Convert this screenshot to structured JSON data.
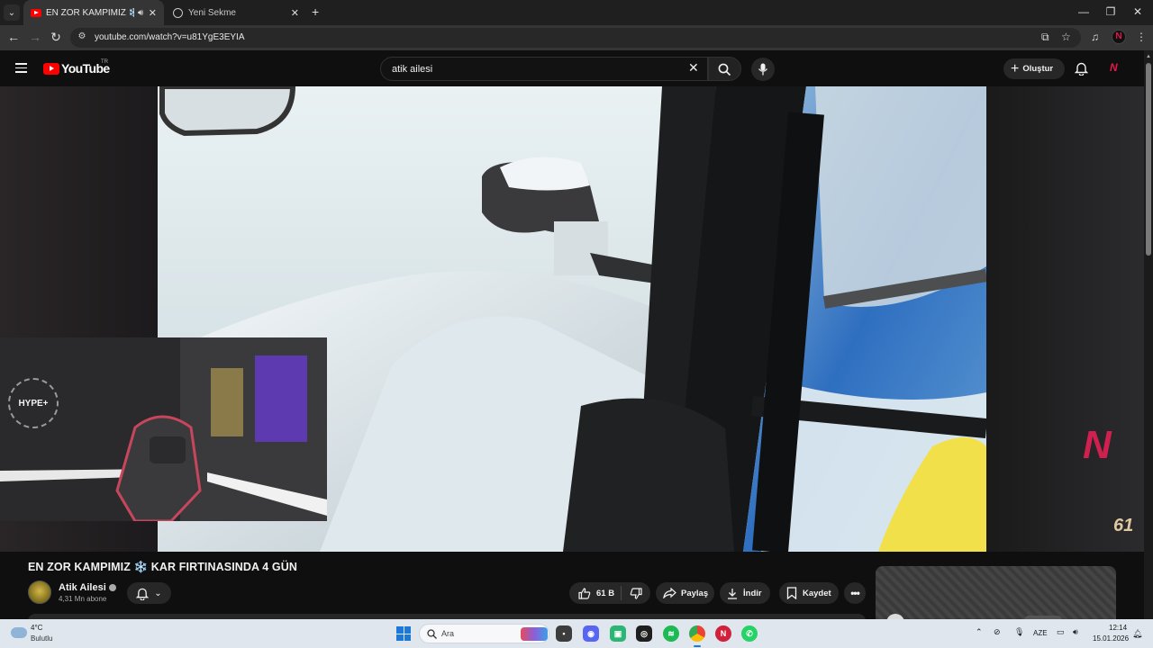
{
  "browser": {
    "tabs": [
      {
        "title": "EN ZOR KAMPIMIZ ❄️ KAR",
        "active": true,
        "audio": true
      },
      {
        "title": "Yeni Sekme",
        "active": false
      }
    ],
    "url": "youtube.com/watch?v=u81YgE3EYIA"
  },
  "youtube": {
    "logo_text": "YouTube",
    "country_code": "TR",
    "search_value": "atik ailesi",
    "create_label": "Oluştur"
  },
  "overlay": {
    "hype_label": "HYPE+",
    "corner_logo": "61"
  },
  "video": {
    "title": "EN ZOR KAMPIMIZ ❄️ KAR FIRTINASINDA 4 GÜN",
    "channel_name": "Atik Ailesi",
    "subscribers": "4,31 Mn abone",
    "likes": "61 B",
    "share_label": "Paylaş",
    "download_label": "İndir",
    "save_label": "Kaydet"
  },
  "taskbar": {
    "weather_temp": "4°C",
    "weather_desc": "Bulutlu",
    "search_placeholder": "Ara",
    "language": "AZE",
    "time": "12:14",
    "date": "15.01.2026"
  },
  "colors": {
    "youtube_red": "#ff0000",
    "background": "#0f0f0f",
    "pill": "#272727",
    "taskbar": "#dfe6ee",
    "accent": "#1e78d6"
  }
}
